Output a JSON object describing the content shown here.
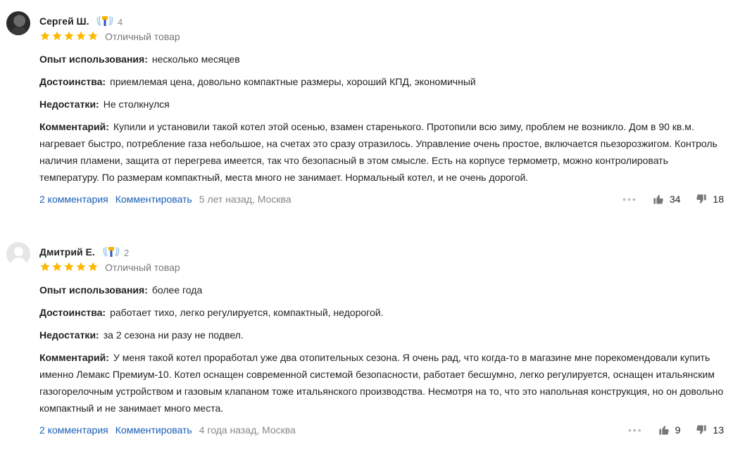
{
  "colors": {
    "star": "#ffb800",
    "link": "#1a5fb4",
    "muted": "#888888"
  },
  "reviews": [
    {
      "author": "Сергей Ш.",
      "badge_icon": "expert-badge-icon",
      "badge_count": "4",
      "rating": 5,
      "rating_text": "Отличный товар",
      "usage_label": "Опыт использования:",
      "usage": "несколько месяцев",
      "pros_label": "Достоинства:",
      "pros": "приемлемая цена, довольно компактные размеры, хороший КПД, экономичный",
      "cons_label": "Недостатки:",
      "cons": "Не столкнулся",
      "comment_label": "Комментарий:",
      "comment": "Купили и установили такой котел этой осенью, взамен старенького. Протопили всю зиму, проблем не возникло. Дом в 90 кв.м. нагревает быстро, потребление газа небольшое, на счетах это сразу отразилось. Управление очень простое, включается пьезорозжигом. Контроль наличия пламени, защита от перегрева имеется, так что безопасный в этом смысле. Есть на корпусе термометр, можно контролировать температуру. По размерам компактный, места много не занимает. Нормальный котел, и не очень дорогой.",
      "comments_link": "2 комментария",
      "reply_link": "Комментировать",
      "meta": "5 лет назад, Москва",
      "likes": "34",
      "dislikes": "18"
    },
    {
      "author": "Дмитрий Е.",
      "badge_icon": "expert-badge-icon",
      "badge_count": "2",
      "rating": 5,
      "rating_text": "Отличный товар",
      "usage_label": "Опыт использования:",
      "usage": "более года",
      "pros_label": "Достоинства:",
      "pros": "работает тихо, легко регулируется, компактный, недорогой.",
      "cons_label": "Недостатки:",
      "cons": "за 2 сезона ни разу не подвел.",
      "comment_label": "Комментарий:",
      "comment": "У меня такой котел проработал уже два отопительных сезона. Я очень рад, что когда-то в магазине мне порекомендовали купить именно Лемакс Премиум-10. Котел оснащен современной системой безопасности, работает бесшумно, легко регулируется, оснащен итальянским газогорелочным устройством и газовым клапаном тоже итальянского производства. Несмотря на то, что это напольная конструкция, но он довольно компактный и не занимает много места.",
      "comments_link": "2 комментария",
      "reply_link": "Комментировать",
      "meta": "4 года назад, Москва",
      "likes": "9",
      "dislikes": "13"
    }
  ]
}
